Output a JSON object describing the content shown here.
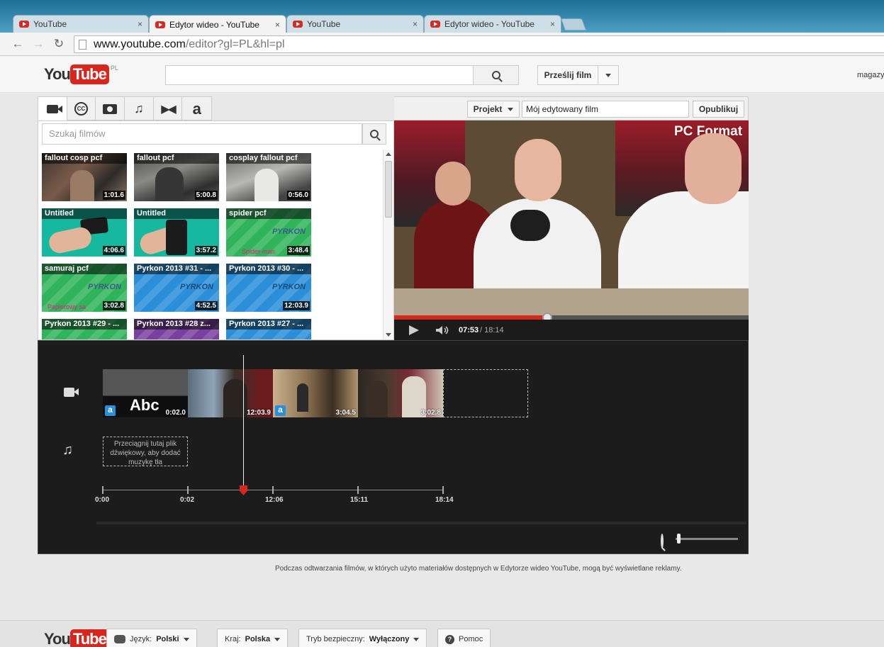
{
  "browser": {
    "tabs": [
      {
        "title": "YouTube",
        "active": false
      },
      {
        "title": "Edytor wideo - YouTube",
        "active": true
      },
      {
        "title": "YouTube",
        "active": false
      },
      {
        "title": "Edytor wideo - YouTube",
        "active": false
      }
    ],
    "close_glyph": "×",
    "url_host": "www.youtube.com",
    "url_path": "/editor?gl=PL&hl=pl"
  },
  "header": {
    "logo_you": "You",
    "logo_tube": "Tube",
    "logo_region": "PL",
    "search_value": "",
    "upload_label": "Prześlij film",
    "user_name": "magazy"
  },
  "editor": {
    "tools": [
      "video-camera-icon",
      "captions-icon",
      "photo-camera-icon",
      "music-note-icon",
      "transitions-icon",
      "text-a-icon"
    ],
    "cc_label": "CC",
    "text_tool_label": "a",
    "library_search_placeholder": "Szukaj filmów",
    "project_label": "Projekt",
    "project_name": "Mój edytowany film",
    "publish_label": "Opublikuj",
    "library": [
      {
        "title": "fallout cosp pcf",
        "duration": "1:01.6",
        "style": "photo"
      },
      {
        "title": "fallout pcf",
        "duration": "5:00.8",
        "style": "photo"
      },
      {
        "title": "cosplay fallout pcf",
        "duration": "0:56.0",
        "style": "photo"
      },
      {
        "title": "Untitled",
        "duration": "4:06.6",
        "style": "teal"
      },
      {
        "title": "Untitled",
        "duration": "3:57.2",
        "style": "teal"
      },
      {
        "title": "spider pcf",
        "duration": "3:48.4",
        "style": "green",
        "caption": "Spider-man"
      },
      {
        "title": "samuraj pcf",
        "duration": "3:02.8",
        "style": "green",
        "caption": "Papierowy sa"
      },
      {
        "title": "Pyrkon 2013 #31 - ...",
        "duration": "4:52.5",
        "style": "blue"
      },
      {
        "title": "Pyrkon 2013 #30 - ...",
        "duration": "12:03.9",
        "style": "blue"
      },
      {
        "title": "Pyrkon 2013 #29 - ...",
        "duration": "",
        "style": "green"
      },
      {
        "title": "Pyrkon 2013 #28 z...",
        "duration": "",
        "style": "purple"
      },
      {
        "title": "Pyrkon 2013 #27 - ...",
        "duration": "",
        "style": "blue"
      }
    ],
    "pyrkon_watermark": "PYRKON"
  },
  "player": {
    "brand_watermark": "PC Format",
    "current_time": "07:53",
    "total_time": "/ 18:14",
    "progress": 0.432
  },
  "timeline": {
    "clips": [
      {
        "label": "Abc",
        "duration": "0:02.0",
        "has_text_badge": true,
        "start": 0,
        "end": 2
      },
      {
        "label": "",
        "duration": "12:03.9",
        "has_text_badge": false,
        "start": 2,
        "end": 726
      },
      {
        "label": "",
        "duration": "3:04.5",
        "has_text_badge": true,
        "start": 726,
        "end": 911
      },
      {
        "label": "",
        "duration": "3:02.8",
        "has_text_badge": false,
        "start": 911,
        "end": 1094
      }
    ],
    "audio_drop_hint": "Przeciągnij tutaj plik dźwiękowy, aby dodać muzykę tła",
    "ruler_labels": [
      "0:00",
      "0:02",
      "12:06",
      "15:11",
      "18:14"
    ],
    "playhead": 0.42,
    "zoom_level": 0.02,
    "badge_glyph": "a"
  },
  "notice": "Podczas odtwarzania filmów, w których użyto materiałów dostępnych w Edytorze wideo YouTube, mogą być wyświetlane reklamy.",
  "footer": {
    "language_label": "Język:",
    "language_value": "Polski",
    "country_label": "Kraj:",
    "country_value": "Polska",
    "safety_label": "Tryb bezpieczny:",
    "safety_value": "Wyłączony",
    "help_label": "Pomoc",
    "help_glyph": "?"
  },
  "colors": {
    "accent_red": "#d6261e",
    "teal_thumb": "#17b8a0",
    "green_thumb": "#2fb45b",
    "blue_thumb": "#2a8fd8",
    "purple_thumb": "#7a3fa0",
    "timeline_bg": "#1c1c1c"
  }
}
